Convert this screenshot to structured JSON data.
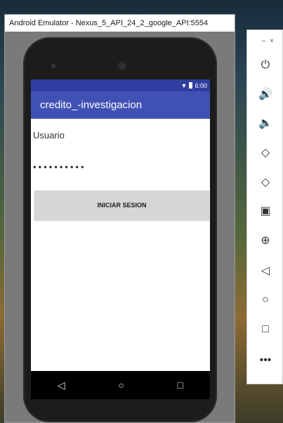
{
  "window": {
    "title": "Android Emulator - Nexus_5_API_24_2_google_API:5554"
  },
  "statusbar": {
    "time": "6:00"
  },
  "app": {
    "title": "credito_-investigacion",
    "username_value": "Usuario",
    "password_value": "••••••••••",
    "login_label": "INICIAR SESION"
  },
  "navbar": {
    "back_icon": "back-icon",
    "home_icon": "home-icon",
    "recents_icon": "recents-icon"
  },
  "toolbar": {
    "minimize": "–",
    "close": "×",
    "items": [
      {
        "name": "power-icon"
      },
      {
        "name": "volume-up-icon"
      },
      {
        "name": "volume-down-icon"
      },
      {
        "name": "rotate-left-icon"
      },
      {
        "name": "rotate-right-icon"
      },
      {
        "name": "camera-icon"
      },
      {
        "name": "zoom-icon"
      },
      {
        "name": "back-icon"
      },
      {
        "name": "home-icon"
      },
      {
        "name": "overview-icon"
      },
      {
        "name": "more-icon"
      }
    ]
  },
  "colors": {
    "primary": "#3f51b5",
    "primary_dark": "#303f9f",
    "button": "#d6d6d6"
  }
}
